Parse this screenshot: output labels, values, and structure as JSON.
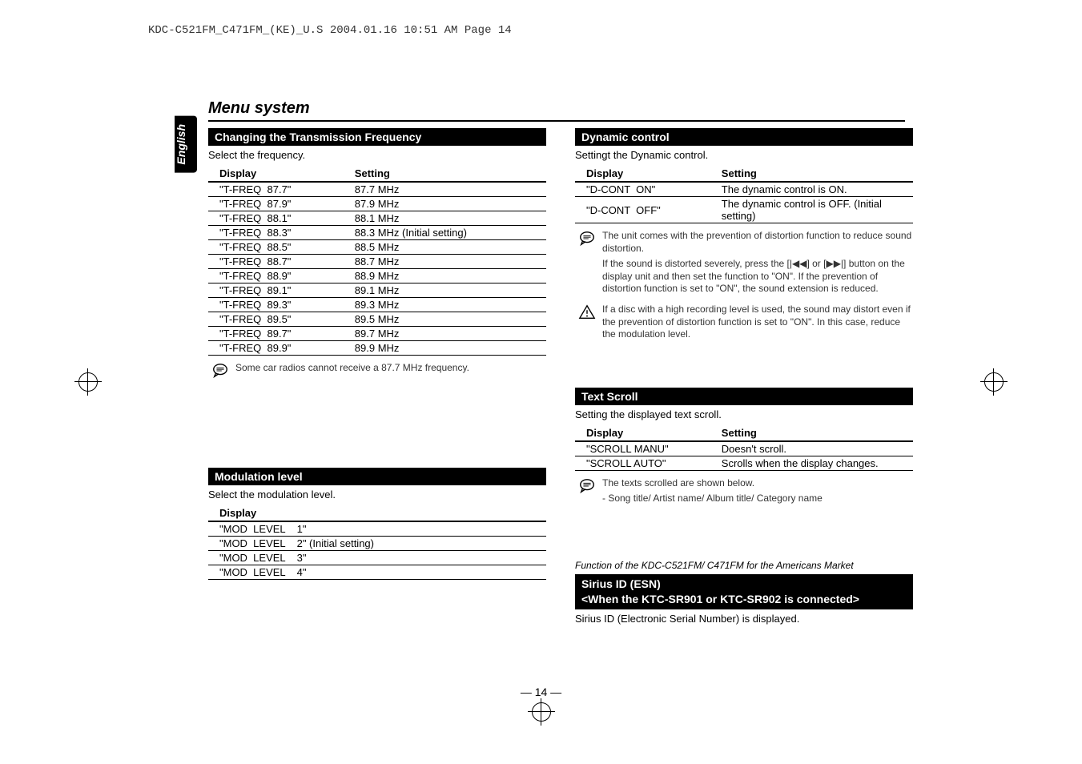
{
  "print_header": "KDC-C521FM_C471FM_(KE)_U.S  2004.01.16  10:51 AM  Page 14",
  "language_tab": "English",
  "page_title": "Menu system",
  "page_number": "— 14 —",
  "sections": {
    "transmission": {
      "header": "Changing the Transmission Frequency",
      "intro": "Select the frequency.",
      "col_display": "Display",
      "col_setting": "Setting",
      "rows": [
        {
          "d": "\"T-FREQ  87.7\"",
          "s": "87.7 MHz"
        },
        {
          "d": "\"T-FREQ  87.9\"",
          "s": "87.9 MHz"
        },
        {
          "d": "\"T-FREQ  88.1\"",
          "s": "88.1 MHz"
        },
        {
          "d": "\"T-FREQ  88.3\"",
          "s": "88.3 MHz (Initial setting)"
        },
        {
          "d": "\"T-FREQ  88.5\"",
          "s": "88.5 MHz"
        },
        {
          "d": "\"T-FREQ  88.7\"",
          "s": "88.7 MHz"
        },
        {
          "d": "\"T-FREQ  88.9\"",
          "s": "88.9 MHz"
        },
        {
          "d": "\"T-FREQ  89.1\"",
          "s": "89.1 MHz"
        },
        {
          "d": "\"T-FREQ  89.3\"",
          "s": "89.3 MHz"
        },
        {
          "d": "\"T-FREQ  89.5\"",
          "s": "89.5 MHz"
        },
        {
          "d": "\"T-FREQ  89.7\"",
          "s": "89.7 MHz"
        },
        {
          "d": "\"T-FREQ  89.9\"",
          "s": "89.9 MHz"
        }
      ],
      "note": "Some car radios cannot receive a 87.7 MHz frequency."
    },
    "modulation": {
      "header": "Modulation level",
      "intro": "Select the modulation level.",
      "col_display": "Display",
      "rows": [
        {
          "d": "\"MOD  LEVEL    1\""
        },
        {
          "d": "\"MOD  LEVEL    2\" (Initial setting)"
        },
        {
          "d": "\"MOD  LEVEL    3\""
        },
        {
          "d": "\"MOD  LEVEL    4\""
        }
      ]
    },
    "dynamic": {
      "header": "Dynamic control",
      "intro": "Settingt the Dynamic control.",
      "col_display": "Display",
      "col_setting": "Setting",
      "rows": [
        {
          "d": "\"D-CONT  ON\"",
          "s": "The dynamic control is ON."
        },
        {
          "d": "\"D-CONT  OFF\"",
          "s": "The dynamic control is OFF. (Initial setting)"
        }
      ],
      "note1a": "The unit comes with the prevention of distortion function to reduce sound distortion.",
      "note1b": "If the sound is distorted severely, press the [|◀◀] or [▶▶|] button on the display unit and then set the function to \"ON\".  If the prevention of distortion function is set to \"ON\", the sound extension is reduced.",
      "warn": "If a disc with a high recording level is used, the sound may distort even if the prevention of distortion function is set to \"ON\".  In this case, reduce the modulation level."
    },
    "textscroll": {
      "header": "Text Scroll",
      "intro": "Setting the displayed text scroll.",
      "col_display": "Display",
      "col_setting": "Setting",
      "rows": [
        {
          "d": "\"SCROLL MANU\"",
          "s": "Doesn't scroll."
        },
        {
          "d": "\"SCROLL AUTO\"",
          "s": "Scrolls when the display changes."
        }
      ],
      "note_a": "The texts scrolled are shown below.",
      "note_b": "- Song title/ Artist name/ Album title/ Category name"
    },
    "sirius": {
      "market_note": "Function of the KDC-C521FM/ C471FM for the Americans Market",
      "header_l1": "Sirius ID (ESN)",
      "header_l2": "<When the KTC-SR901 or KTC-SR902 is connected>",
      "body": "Sirius ID (Electronic Serial Number) is displayed."
    }
  }
}
